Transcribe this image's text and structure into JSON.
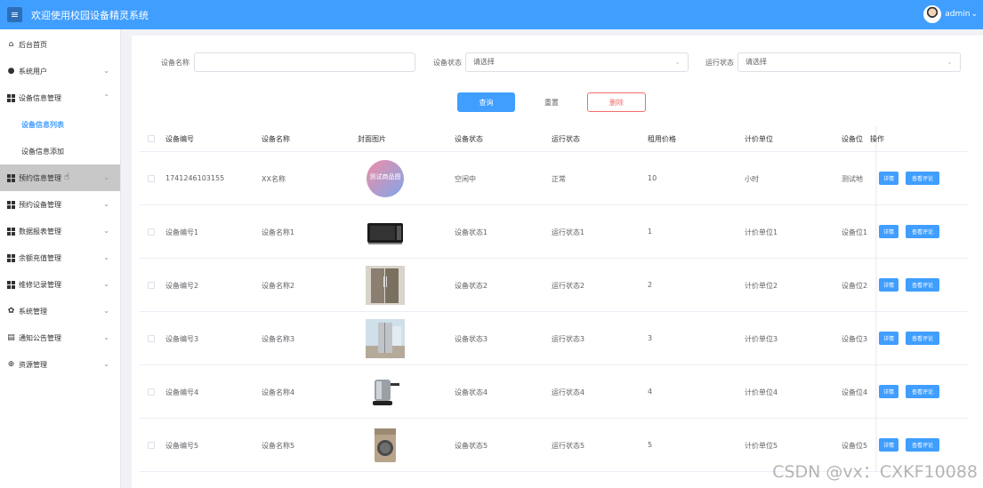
{
  "header": {
    "title": "欢迎使用校园设备精灵系统",
    "user": "admin"
  },
  "sidebar": {
    "items": [
      {
        "label": "后台首页",
        "icon": "home-icon"
      },
      {
        "label": "系统用户",
        "icon": "user-icon"
      },
      {
        "label": "设备信息管理",
        "icon": "grid-icon",
        "expanded": true,
        "children": [
          {
            "label": "设备信息列表",
            "active": true
          },
          {
            "label": "设备信息添加"
          }
        ]
      },
      {
        "label": "预约信息管理",
        "icon": "grid-icon",
        "hover": true
      },
      {
        "label": "预约设备管理",
        "icon": "grid-icon"
      },
      {
        "label": "数据报表管理",
        "icon": "grid-icon"
      },
      {
        "label": "余额充值管理",
        "icon": "grid-icon"
      },
      {
        "label": "维修记录管理",
        "icon": "grid-icon"
      },
      {
        "label": "系统管理",
        "icon": "gear-icon"
      },
      {
        "label": "通知公告管理",
        "icon": "notice-icon"
      },
      {
        "label": "资源管理",
        "icon": "plus-circle-icon"
      }
    ]
  },
  "filters": {
    "name_label": "设备名称",
    "name_value": "",
    "status_label": "设备状态",
    "status_placeholder": "请选择",
    "run_label": "运行状态",
    "run_placeholder": "请选择"
  },
  "buttons": {
    "query": "查询",
    "reset": "重置",
    "delete": "删除"
  },
  "table": {
    "headers": [
      "设备编号",
      "设备名称",
      "封面图片",
      "设备状态",
      "运行状态",
      "租用价格",
      "计价单位",
      "设备位",
      "操作"
    ],
    "rows": [
      {
        "id": "1741246103155",
        "name": "XX名称",
        "image": "sample-badge",
        "image_text": "测试商品图",
        "status": "空闲中",
        "run": "正常",
        "price": "10",
        "unit": "小时",
        "loc": "测试地"
      },
      {
        "id": "设备编号1",
        "name": "设备名称1",
        "image": "microwave",
        "status": "设备状态1",
        "run": "运行状态1",
        "price": "1",
        "unit": "计价单位1",
        "loc": "设备位1"
      },
      {
        "id": "设备编号2",
        "name": "设备名称2",
        "image": "fridge",
        "status": "设备状态2",
        "run": "运行状态2",
        "price": "2",
        "unit": "计价单位2",
        "loc": "设备位2"
      },
      {
        "id": "设备编号3",
        "name": "设备名称3",
        "image": "fridge-room",
        "status": "设备状态3",
        "run": "运行状态3",
        "price": "3",
        "unit": "计价单位3",
        "loc": "设备位3"
      },
      {
        "id": "设备编号4",
        "name": "设备名称4",
        "image": "kettle",
        "status": "设备状态4",
        "run": "运行状态4",
        "price": "4",
        "unit": "计价单位4",
        "loc": "设备位4"
      },
      {
        "id": "设备编号5",
        "name": "设备名称5",
        "image": "washer",
        "status": "设备状态5",
        "run": "运行状态5",
        "price": "5",
        "unit": "计价单位5",
        "loc": "设备位5"
      }
    ],
    "action_detail": "详情",
    "action_review": "查看评论"
  },
  "watermark": "CSDN @vx：CXKF10088",
  "colors": {
    "primary": "#409eff",
    "danger": "#f56c6c"
  }
}
